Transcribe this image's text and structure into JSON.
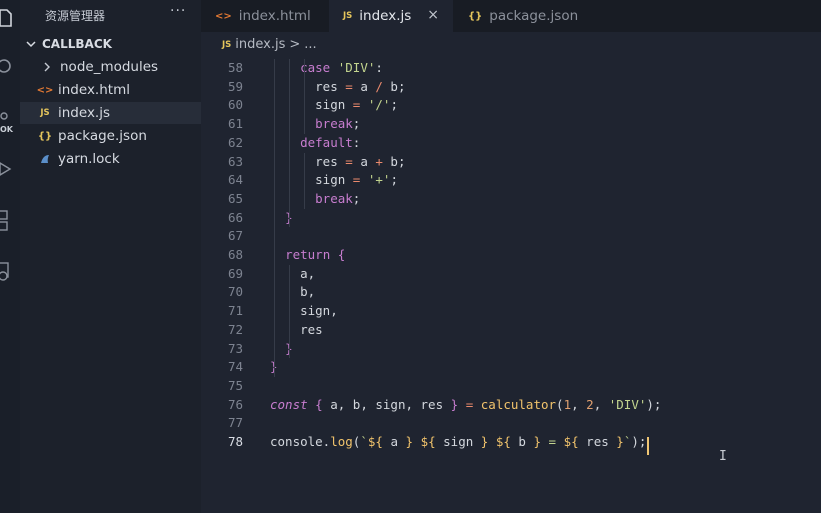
{
  "activity_bar": {
    "items": [
      "files-icon",
      "search-icon",
      "source-control-icon",
      "run-debug-icon",
      "extensions-icon",
      "remote-icon"
    ],
    "badge": "OK"
  },
  "sidebar": {
    "title": "资源管理器",
    "more": "···",
    "section": "CALLBACK",
    "items": [
      {
        "label": "node_modules",
        "icon": "chevron-right-icon",
        "active": false
      },
      {
        "label": "index.html",
        "icon": "html-file-icon",
        "icon_text": "<>",
        "active": false
      },
      {
        "label": "index.js",
        "icon": "js-file-icon",
        "icon_text": "JS",
        "active": true
      },
      {
        "label": "package.json",
        "icon": "json-file-icon",
        "icon_text": "{}",
        "active": false
      },
      {
        "label": "yarn.lock",
        "icon": "yarn-file-icon",
        "active": false
      }
    ]
  },
  "tabs": [
    {
      "label": "index.html",
      "icon_text": "<>",
      "active": false
    },
    {
      "label": "index.js",
      "icon_text": "JS",
      "active": true,
      "close": "×"
    },
    {
      "label": "package.json",
      "icon_text": "{}",
      "active": false
    }
  ],
  "breadcrumb": {
    "icon_text": "JS",
    "file": "index.js",
    "sep": ">",
    "tail": "..."
  },
  "editor": {
    "cursor_line": 78,
    "lines": [
      {
        "n": "58",
        "text": "    case 'DIV':"
      },
      {
        "n": "59",
        "text": "      res = a / b;"
      },
      {
        "n": "60",
        "text": "      sign = '/';"
      },
      {
        "n": "61",
        "text": "      break;"
      },
      {
        "n": "62",
        "text": "    default:"
      },
      {
        "n": "63",
        "text": "      res = a + b;"
      },
      {
        "n": "64",
        "text": "      sign = '+';"
      },
      {
        "n": "65",
        "text": "      break;"
      },
      {
        "n": "66",
        "text": "  }"
      },
      {
        "n": "67",
        "text": ""
      },
      {
        "n": "68",
        "text": "  return {"
      },
      {
        "n": "69",
        "text": "    a,"
      },
      {
        "n": "70",
        "text": "    b,"
      },
      {
        "n": "71",
        "text": "    sign,"
      },
      {
        "n": "72",
        "text": "    res"
      },
      {
        "n": "73",
        "text": "  }"
      },
      {
        "n": "74",
        "text": "}"
      },
      {
        "n": "75",
        "text": ""
      },
      {
        "n": "76",
        "text": "const { a, b, sign, res } = calculator(1, 2, 'DIV');"
      },
      {
        "n": "77",
        "text": ""
      },
      {
        "n": "78",
        "text": "console.log(`${ a } ${ sign } ${ b } = ${ res }`);"
      }
    ]
  },
  "colors": {
    "editor_bg": "#1f2430",
    "sidebar_bg": "#1c212b",
    "keyword": "#c77dcf",
    "string": "#c3d58f",
    "function": "#f2c46c",
    "number": "#e0a070",
    "js_icon": "#e6c65c",
    "html_icon": "#e37933"
  }
}
